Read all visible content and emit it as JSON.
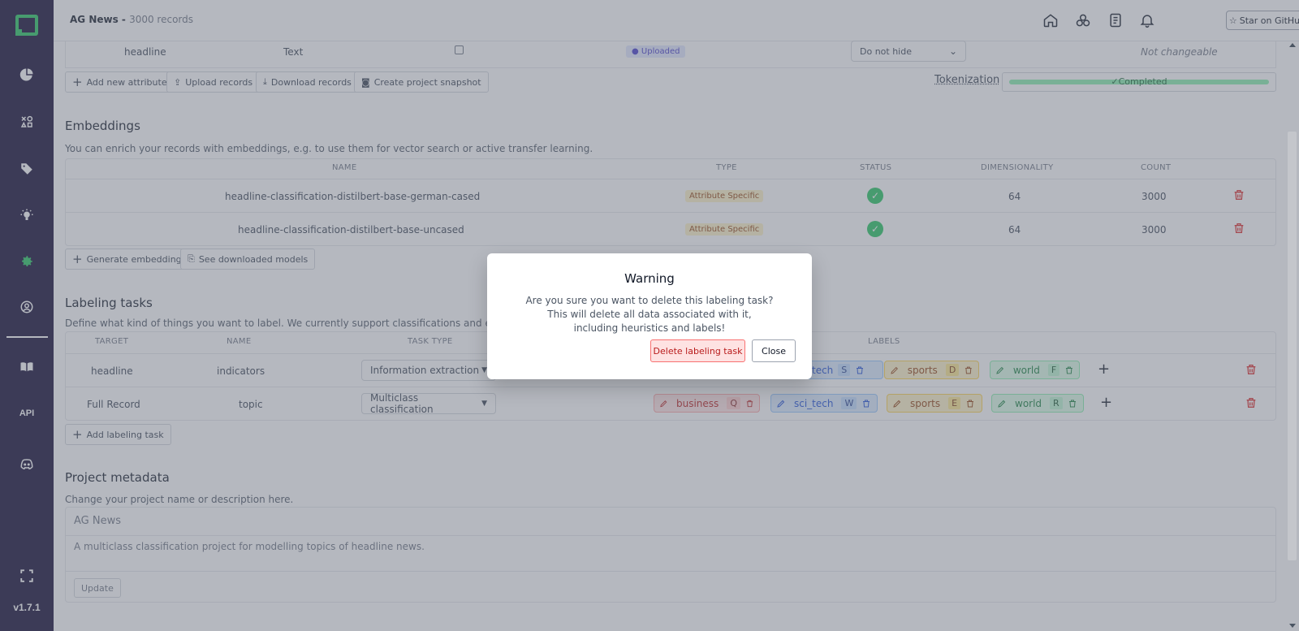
{
  "header": {
    "project_name": "AG News - ",
    "record_count": "3000 records",
    "star_label": "Star on GitHub"
  },
  "sidebar": {
    "api_label": "API",
    "version": "v1.7.1"
  },
  "attribute_row": {
    "name": "headline",
    "type": "Text",
    "status": "Uploaded",
    "visibility": "Do not hide",
    "changeable": "Not changeable"
  },
  "attribute_buttons": {
    "add": "Add new attribute",
    "upload": "Upload records",
    "download": "Download records",
    "snapshot": "Create project snapshot",
    "tokenization_label": "Tokenization",
    "tokenization_status": "Completed",
    "tokenization_progress": 1.0
  },
  "embeddings": {
    "title": "Embeddings",
    "description": "You can enrich your records with embeddings, e.g. to use them for vector search or active transfer learning.",
    "columns": [
      "NAME",
      "TYPE",
      "STATUS",
      "DIMENSIONALITY",
      "COUNT"
    ],
    "rows": [
      {
        "name": "headline-classification-distilbert-base-german-cased",
        "type": "Attribute Specific",
        "dim": "64",
        "count": "3000"
      },
      {
        "name": "headline-classification-distilbert-base-uncased",
        "type": "Attribute Specific",
        "dim": "64",
        "count": "3000"
      }
    ],
    "generate": "Generate embedding",
    "models": "See downloaded models"
  },
  "labeling": {
    "title": "Labeling tasks",
    "description": "Define what kind of things you want to label. We currently support classifications and extractions.",
    "columns": [
      "TARGET",
      "NAME",
      "TASK TYPE",
      "LABELS"
    ],
    "rows": [
      {
        "target": "headline",
        "name": "indicators",
        "task_type": "Information extraction",
        "labels": [
          {
            "name": "tech",
            "key": "S",
            "color": "blue"
          },
          {
            "name": "sports",
            "key": "D",
            "color": "yellow"
          },
          {
            "name": "world",
            "key": "F",
            "color": "green"
          }
        ]
      },
      {
        "target": "Full Record",
        "name": "topic",
        "task_type": "Multiclass classification",
        "labels": [
          {
            "name": "business",
            "key": "Q",
            "color": "red"
          },
          {
            "name": "sci_tech",
            "key": "W",
            "color": "blue"
          },
          {
            "name": "sports",
            "key": "E",
            "color": "yellow"
          },
          {
            "name": "world",
            "key": "R",
            "color": "green"
          }
        ]
      }
    ],
    "add": "Add labeling task"
  },
  "metadata": {
    "title": "Project metadata",
    "description": "Change your project name or description here.",
    "name_value": "AG News",
    "desc_value": "A multiclass classification project for modelling topics of headline news.",
    "update": "Update"
  },
  "modal": {
    "title": "Warning",
    "line1": "Are you sure you want to delete this labeling task?",
    "line2": "This will delete all data associated with it,",
    "line3": "including heuristics and labels!",
    "delete": "Delete labeling task",
    "close": "Close"
  },
  "colors": {
    "sidebar_bg": "#0c052e",
    "accent_green": "#22c55e",
    "danger_red": "#dc2626"
  }
}
